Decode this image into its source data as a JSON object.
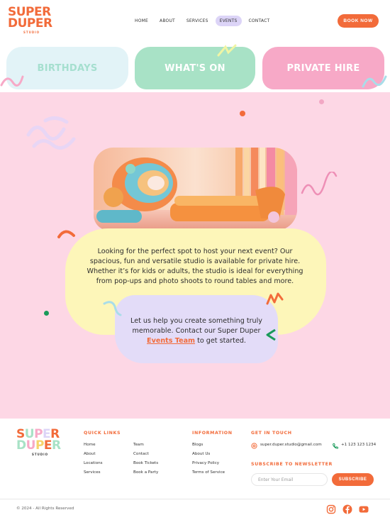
{
  "brand": {
    "logo_line1": "SUPER",
    "logo_line2": "DUPER",
    "logo_sub": "STUDIO",
    "accent": "#f26b3a"
  },
  "nav": {
    "items": [
      "HOME",
      "ABOUT",
      "SERVICES",
      "EVENTS",
      "CONTACT"
    ],
    "active": "EVENTS",
    "book_label": "BOOK NOW"
  },
  "tiles": [
    {
      "label": "BIRTHDAYS",
      "color": "#e2f3f7"
    },
    {
      "label": "WHAT'S ON",
      "color": "#a8e2c6"
    },
    {
      "label": "PRIVATE HIRE",
      "color": "#f7a9c7"
    }
  ],
  "hero": {
    "image_alt": "studio-lounge-image",
    "main_text": "Looking for the perfect spot to host your next event? Our spacious, fun and versatile studio is available for private hire. Whether it’s for kids or adults, the studio is ideal for everything from pop-ups and photo shoots to round tables and more.",
    "cta_before": "Let us help you create something truly memorable. Contact our Super Duper",
    "cta_link": "Events Team",
    "cta_after": "to get started.",
    "background": "#fdd7e5"
  },
  "footer": {
    "quick_links_title": "QUICK LINKS",
    "quick_links_col1": [
      "Home",
      "About",
      "Locations",
      "Services"
    ],
    "quick_links_col2": [
      "Team",
      "Contact",
      "Book Tickets",
      "Book a Party"
    ],
    "information_title": "INFORMATION",
    "information_links": [
      "Blogs",
      "About Us",
      "Privacy Policy",
      "Terms of Service"
    ],
    "contact_title": "GET IN TOUCH",
    "email": "super.duper.studio@gmail.com",
    "phone": "+1 123 123 1234",
    "newsletter_title": "SUBSCRIBE TO NEWSLETTER",
    "email_placeholder": "Enter Your Email",
    "subscribe_label": "SUBSCRIBE",
    "copyright": "© 2024 - All Rights Reserved",
    "socials": [
      "instagram-icon",
      "facebook-icon",
      "youtube-icon"
    ]
  }
}
